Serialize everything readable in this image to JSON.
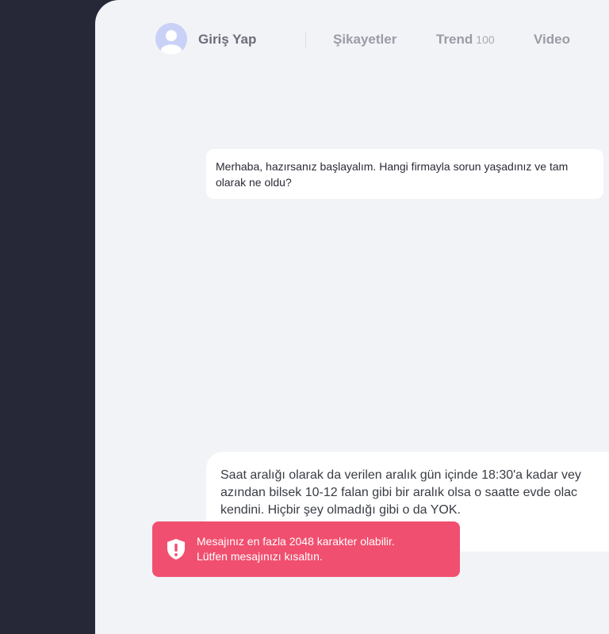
{
  "nav": {
    "login_label": "Giriş Yap",
    "items": [
      {
        "label": "Şikayetler"
      },
      {
        "label": "Trend",
        "count": "100"
      },
      {
        "label": "Video"
      }
    ]
  },
  "chat": {
    "bot_message": "Merhaba, hazırsanız başlayalım. Hangi firmayla sorun yaşadınız ve tam olarak ne oldu?",
    "user_message_lines": [
      "Saat aralığı olarak da verilen aralık gün içinde 18:30'a kadar vey",
      "azından bilsek 10-12 falan gibi bir aralık olsa o saatte evde olac",
      "kendini. Hiçbir şey olmadığı gibi o da YOK."
    ]
  },
  "toast": {
    "line1": "Mesajınız en fazla 2048 karakter olabilir.",
    "line2": "Lütfen mesajınızı kısaltın.",
    "icon": "shield-alert-icon",
    "color": "#f14f6f"
  },
  "colors": {
    "sidebar": "#262837",
    "panel": "#f2f3f7",
    "avatar": "#c9d2f6"
  }
}
